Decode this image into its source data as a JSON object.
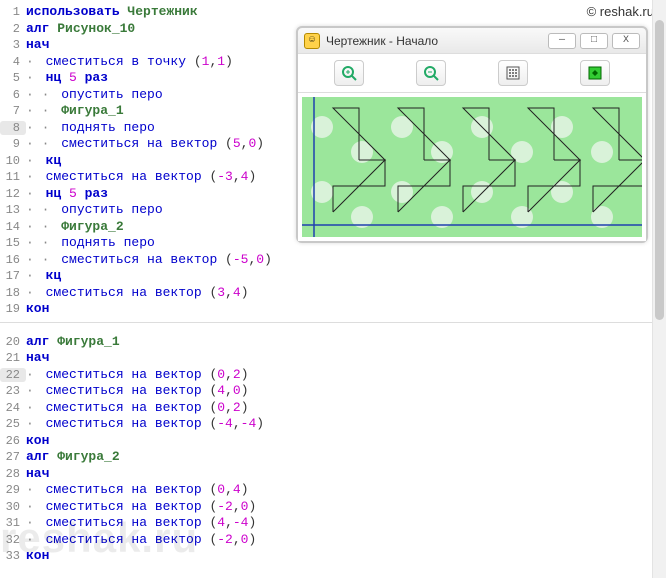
{
  "watermark_url": "© reshak.ru",
  "watermark_text": "reshak.ru",
  "window": {
    "title": "Чертежник - Начало",
    "buttons": {
      "min": "—",
      "max": "□",
      "close": "X"
    },
    "toolbar": [
      "zoom-in",
      "zoom-out",
      "grid",
      "fit"
    ]
  },
  "code": {
    "block1": [
      {
        "n": 1,
        "tokens": [
          [
            "kw",
            "использовать "
          ],
          [
            "ident",
            "Чертежник"
          ]
        ]
      },
      {
        "n": 2,
        "tokens": [
          [
            "kw",
            "алг "
          ],
          [
            "ident",
            "Рисунок_10"
          ]
        ]
      },
      {
        "n": 3,
        "tokens": [
          [
            "kw",
            "нач"
          ]
        ]
      },
      {
        "n": 4,
        "dot": true,
        "tokens": [
          [
            "cmd",
            "сместиться в точку "
          ],
          [
            "sep",
            "("
          ],
          [
            "num",
            "1"
          ],
          [
            "sep",
            ","
          ],
          [
            "num",
            "1"
          ],
          [
            "sep",
            ")"
          ]
        ]
      },
      {
        "n": 5,
        "dot": true,
        "tokens": [
          [
            "kw",
            "нц "
          ],
          [
            "num",
            "5"
          ],
          [
            "kw",
            " раз"
          ]
        ]
      },
      {
        "n": 6,
        "dot2": true,
        "tokens": [
          [
            "cmd",
            "опустить перо"
          ]
        ]
      },
      {
        "n": 7,
        "dot2": true,
        "tokens": [
          [
            "ident",
            "Фигура_1"
          ]
        ]
      },
      {
        "n": 8,
        "hl": true,
        "dot2": true,
        "tokens": [
          [
            "cmd",
            "поднять перо"
          ]
        ]
      },
      {
        "n": 9,
        "dot2": true,
        "tokens": [
          [
            "cmd",
            "сместиться на вектор "
          ],
          [
            "sep",
            "("
          ],
          [
            "num",
            "5"
          ],
          [
            "sep",
            ","
          ],
          [
            "num",
            "0"
          ],
          [
            "sep",
            ")"
          ]
        ]
      },
      {
        "n": 10,
        "dot": true,
        "tokens": [
          [
            "kw",
            "кц"
          ]
        ]
      },
      {
        "n": 11,
        "dot": true,
        "tokens": [
          [
            "cmd",
            "сместиться на вектор "
          ],
          [
            "sep",
            "("
          ],
          [
            "num",
            "-3"
          ],
          [
            "sep",
            ","
          ],
          [
            "num",
            "4"
          ],
          [
            "sep",
            ")"
          ]
        ]
      },
      {
        "n": 12,
        "dot": true,
        "tokens": [
          [
            "kw",
            "нц "
          ],
          [
            "num",
            "5"
          ],
          [
            "kw",
            " раз"
          ]
        ]
      },
      {
        "n": 13,
        "dot2": true,
        "tokens": [
          [
            "cmd",
            "опустить перо"
          ]
        ]
      },
      {
        "n": 14,
        "dot2": true,
        "tokens": [
          [
            "ident",
            "Фигура_2"
          ]
        ]
      },
      {
        "n": 15,
        "dot2": true,
        "tokens": [
          [
            "cmd",
            "поднять перо"
          ]
        ]
      },
      {
        "n": 16,
        "dot2": true,
        "tokens": [
          [
            "cmd",
            "сместиться на вектор "
          ],
          [
            "sep",
            "("
          ],
          [
            "num",
            "-5"
          ],
          [
            "sep",
            ","
          ],
          [
            "num",
            "0"
          ],
          [
            "sep",
            ")"
          ]
        ]
      },
      {
        "n": 17,
        "dot": true,
        "tokens": [
          [
            "kw",
            "кц"
          ]
        ]
      },
      {
        "n": 18,
        "dot": true,
        "tokens": [
          [
            "cmd",
            "сместиться на вектор "
          ],
          [
            "sep",
            "("
          ],
          [
            "num",
            "3"
          ],
          [
            "sep",
            ","
          ],
          [
            "num",
            "4"
          ],
          [
            "sep",
            ")"
          ]
        ]
      },
      {
        "n": 19,
        "tokens": [
          [
            "kw",
            "кон"
          ]
        ]
      }
    ],
    "block2": [
      {
        "n": 20,
        "tokens": [
          [
            "kw",
            "алг "
          ],
          [
            "ident",
            "Фигура_1"
          ]
        ]
      },
      {
        "n": 21,
        "tokens": [
          [
            "kw",
            "нач"
          ]
        ]
      },
      {
        "n": 22,
        "hl": true,
        "dot": true,
        "tokens": [
          [
            "cmd",
            "сместиться на вектор "
          ],
          [
            "sep",
            "("
          ],
          [
            "num",
            "0"
          ],
          [
            "sep",
            ","
          ],
          [
            "num",
            "2"
          ],
          [
            "sep",
            ")"
          ]
        ]
      },
      {
        "n": 23,
        "dot": true,
        "tokens": [
          [
            "cmd",
            "сместиться на вектор "
          ],
          [
            "sep",
            "("
          ],
          [
            "num",
            "4"
          ],
          [
            "sep",
            ","
          ],
          [
            "num",
            "0"
          ],
          [
            "sep",
            ")"
          ]
        ]
      },
      {
        "n": 24,
        "dot": true,
        "tokens": [
          [
            "cmd",
            "сместиться на вектор "
          ],
          [
            "sep",
            "("
          ],
          [
            "num",
            "0"
          ],
          [
            "sep",
            ","
          ],
          [
            "num",
            "2"
          ],
          [
            "sep",
            ")"
          ]
        ]
      },
      {
        "n": 25,
        "dot": true,
        "tokens": [
          [
            "cmd",
            "сместиться на вектор "
          ],
          [
            "sep",
            "("
          ],
          [
            "num",
            "-4"
          ],
          [
            "sep",
            ","
          ],
          [
            "num",
            "-4"
          ],
          [
            "sep",
            ")"
          ]
        ]
      },
      {
        "n": 26,
        "tokens": [
          [
            "kw",
            "кон"
          ]
        ]
      },
      {
        "n": 27,
        "tokens": [
          [
            "kw",
            "алг "
          ],
          [
            "ident",
            "Фигура_2"
          ]
        ]
      },
      {
        "n": 28,
        "tokens": [
          [
            "kw",
            "нач"
          ]
        ]
      },
      {
        "n": 29,
        "dot": true,
        "tokens": [
          [
            "cmd",
            "сместиться на вектор "
          ],
          [
            "sep",
            "("
          ],
          [
            "num",
            "0"
          ],
          [
            "sep",
            ","
          ],
          [
            "num",
            "4"
          ],
          [
            "sep",
            ")"
          ]
        ]
      },
      {
        "n": 30,
        "dot": true,
        "tokens": [
          [
            "cmd",
            "сместиться на вектор "
          ],
          [
            "sep",
            "("
          ],
          [
            "num",
            "-2"
          ],
          [
            "sep",
            ","
          ],
          [
            "num",
            "0"
          ],
          [
            "sep",
            ")"
          ]
        ]
      },
      {
        "n": 31,
        "dot": true,
        "tokens": [
          [
            "cmd",
            "сместиться на вектор "
          ],
          [
            "sep",
            "("
          ],
          [
            "num",
            "4"
          ],
          [
            "sep",
            ","
          ],
          [
            "num",
            "-4"
          ],
          [
            "sep",
            ")"
          ]
        ]
      },
      {
        "n": 32,
        "dot": true,
        "tokens": [
          [
            "cmd",
            "сместиться на вектор "
          ],
          [
            "sep",
            "("
          ],
          [
            "num",
            "-2"
          ],
          [
            "sep",
            ","
          ],
          [
            "num",
            "0"
          ],
          [
            "sep",
            ")"
          ]
        ]
      },
      {
        "n": 33,
        "tokens": [
          [
            "kw",
            "кон"
          ]
        ]
      }
    ]
  }
}
